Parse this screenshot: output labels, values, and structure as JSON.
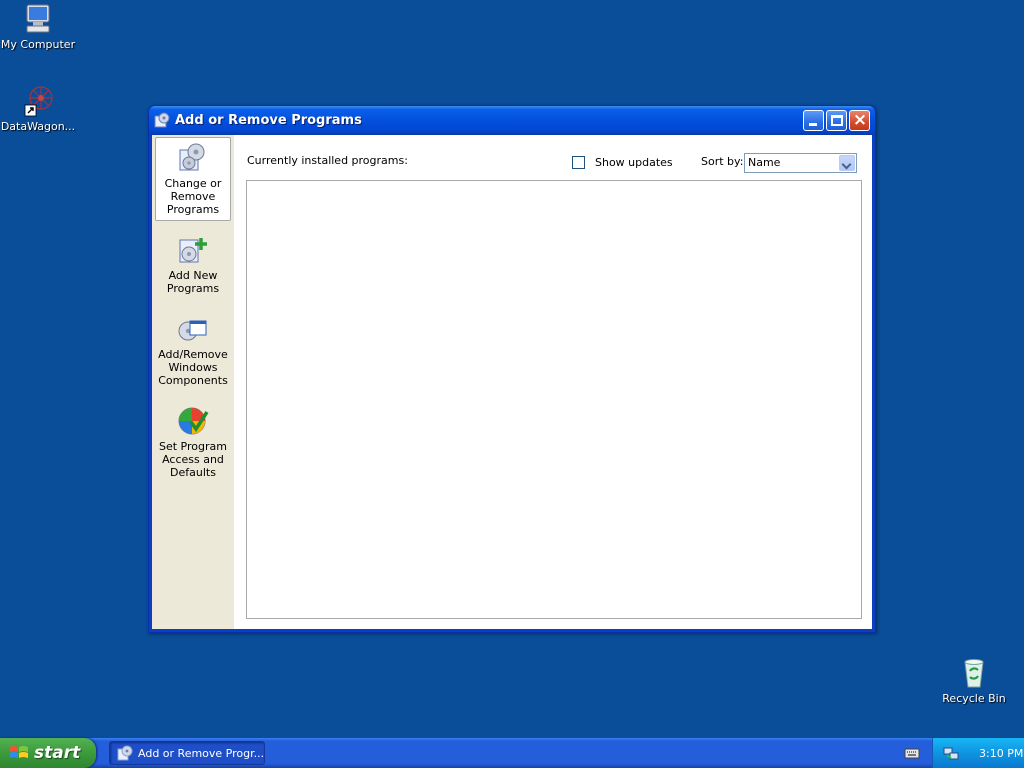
{
  "desktop": {
    "icons": [
      {
        "label": "My Computer",
        "icon": "my-computer-icon"
      },
      {
        "label": "DataWagon...",
        "icon": "datawagon-shortcut-icon"
      },
      {
        "label": "Recycle Bin",
        "icon": "recycle-bin-icon"
      }
    ]
  },
  "window": {
    "title": "Add or Remove Programs",
    "sidebar": {
      "items": [
        {
          "label": "Change or Remove Programs",
          "icon": "change-remove-programs-icon",
          "active": true
        },
        {
          "label": "Add New Programs",
          "icon": "add-new-programs-icon",
          "active": false
        },
        {
          "label": "Add/Remove Windows Components",
          "icon": "windows-components-icon",
          "active": false
        },
        {
          "label": "Set Program Access and Defaults",
          "icon": "program-access-defaults-icon",
          "active": false
        }
      ]
    },
    "main": {
      "installed_label": "Currently installed programs:",
      "show_updates_label": "Show updates",
      "show_updates_checked": false,
      "sort_by_label": "Sort by:",
      "sort_by_value": "Name",
      "programs": []
    }
  },
  "taskbar": {
    "start_label": "start",
    "task_button_label": "Add or Remove Progr...",
    "clock": "3:10 PM"
  },
  "colors": {
    "desktop_bg": "#0a4d98",
    "titlebar": "#0250de",
    "start_green": "#3c9b3c",
    "taskbar_blue": "#245edb",
    "tray_blue": "#0f94e0"
  }
}
